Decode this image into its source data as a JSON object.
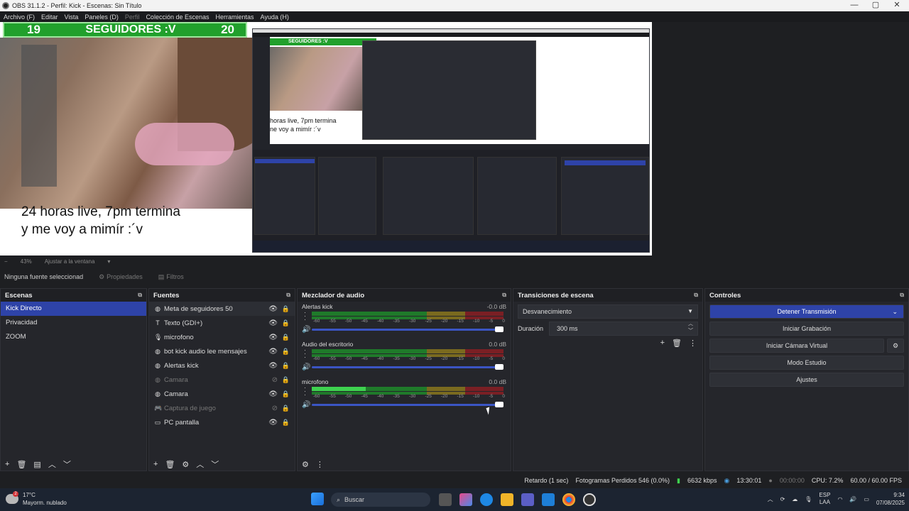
{
  "window": {
    "title": "OBS 31.1.2 - Perfil: Kick - Escenas: Sin Título",
    "minimize": "—",
    "maximize": "▢",
    "close": "✕"
  },
  "menu": [
    "Archivo (F)",
    "Editar",
    "Vista",
    "Paneles (D)",
    "Perfil",
    "Colección de Escenas",
    "Herramientas",
    "Ayuda (H)"
  ],
  "preview": {
    "hud_left": "19",
    "hud_title": "SEGUIDORES :V",
    "hud_right": "20",
    "caption_line1": "24 horas live, 7pm termina",
    "caption_line2": "y me voy a mimír :´v",
    "nested_hud": "SEGUIDORES :V",
    "nested_caption1": "horas live, 7pm termina",
    "nested_caption2": "ne voy a mimír :´v"
  },
  "preview_bar": {
    "zoom": "43%",
    "fit": "Ajustar a la ventana"
  },
  "source_bar": {
    "status": "Ninguna fuente seleccionad",
    "properties": "Propiedades",
    "filters": "Filtros"
  },
  "scenes": {
    "title": "Escenas",
    "items": [
      "Kick Directo",
      "Privacidad",
      "ZOOM"
    ]
  },
  "sources": {
    "title": "Fuentes",
    "items": [
      {
        "label": "Meta de seguidores 50",
        "icon": "browser-icon",
        "visible": true
      },
      {
        "label": "Texto (GDI+)",
        "icon": "text-icon",
        "visible": true
      },
      {
        "label": "microfono",
        "icon": "mic-icon",
        "visible": true
      },
      {
        "label": "bot kick audio lee mensajes",
        "icon": "browser-icon",
        "visible": true
      },
      {
        "label": "Alertas kick",
        "icon": "browser-icon",
        "visible": true
      },
      {
        "label": "Camara",
        "icon": "browser-icon",
        "visible": false
      },
      {
        "label": "Camara",
        "icon": "browser-icon",
        "visible": true
      },
      {
        "label": "Captura de juego",
        "icon": "gamepad-icon",
        "visible": false
      },
      {
        "label": "PC pantalla",
        "icon": "monitor-icon",
        "visible": true
      }
    ]
  },
  "mixer": {
    "title": "Mezclador de audio",
    "scale": [
      "-60",
      "-55",
      "-50",
      "-45",
      "-40",
      "-35",
      "-30",
      "-25",
      "-20",
      "-15",
      "-10",
      "-5",
      "0"
    ],
    "channels": [
      {
        "name": "Alertas kick",
        "db": "-0.0 dB",
        "level": 0
      },
      {
        "name": "Audio del escritorio",
        "db": "0.0 dB",
        "level": 0
      },
      {
        "name": "microfono",
        "db": "0.0 dB",
        "level": 0.28
      }
    ]
  },
  "transitions": {
    "title": "Transiciones de escena",
    "type": "Desvanecimiento",
    "duration_label": "Duración",
    "duration": "300 ms"
  },
  "controls": {
    "title": "Controles",
    "stream": "Detener Transmisión",
    "record": "Iniciar Grabación",
    "vcam": "Iniciar Cámara Virtual",
    "studio": "Modo Estudio",
    "settings": "Ajustes"
  },
  "status": {
    "delay": "Retardo (1 sec)",
    "dropped": "Fotogramas Perdidos 546 (0.0%)",
    "bitrate": "6632 kbps",
    "live_time": "13:30:01",
    "rec_time": "00:00:00",
    "cpu": "CPU: 7.2%",
    "fps": "60.00 / 60.00 FPS"
  },
  "taskbar": {
    "weather_temp": "17°C",
    "weather_desc": "Mayorm. nublado",
    "weather_badge": "2",
    "search": "Buscar",
    "lang1": "ESP",
    "lang2": "LAA",
    "time": "9:34",
    "date": "07/08/2025"
  },
  "colors": {
    "accent": "#2e43a8",
    "hud_green": "#21a02c"
  }
}
